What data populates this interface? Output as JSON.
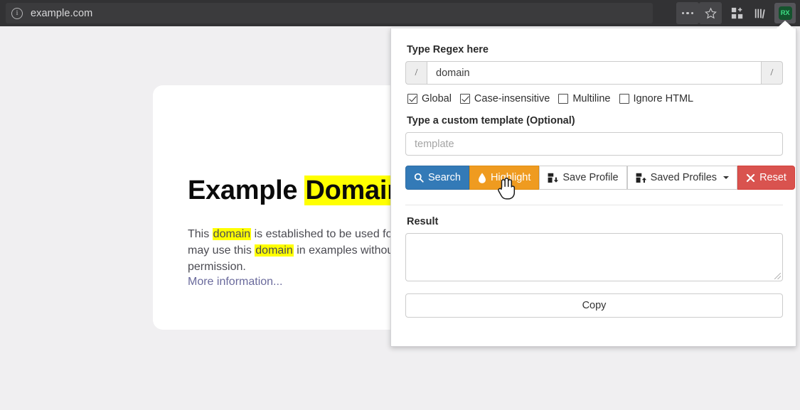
{
  "browser": {
    "url": "example.com",
    "info_icon": "info-icon",
    "actions": [
      {
        "name": "page-actions-ellipsis",
        "icon": "ellipsis-icon"
      },
      {
        "name": "bookmark-star",
        "icon": "star-icon"
      },
      {
        "name": "extensions-add",
        "icon": "extensions-grid-plus-icon"
      },
      {
        "name": "library",
        "icon": "library-bars-icon"
      }
    ],
    "extension_button": {
      "label": "RX",
      "icon": "regex-extension-icon",
      "active": true
    },
    "chrome_bg": "#323234",
    "urlbar_bg": "#3b3b3d"
  },
  "webpage": {
    "heading_pre": "Example ",
    "heading_highlight": "Domain",
    "paragraph_1": "This ",
    "paragraph_hl_1": "domain",
    "paragraph_2": " is established to be used fo",
    "paragraph_3": "may use this ",
    "paragraph_hl_2": "domain",
    "paragraph_4": " in examples withou",
    "paragraph_5": "permission.",
    "link": "More information...",
    "highlight_color": "#ffff00",
    "background": "#f0eff1"
  },
  "popup": {
    "regex_label": "Type Regex here",
    "regex_prefix": "/",
    "regex_suffix": "/",
    "regex_value": "domain",
    "regex_placeholder": "",
    "options": [
      {
        "label": "Global",
        "checked": true
      },
      {
        "label": "Case-insensitive",
        "checked": true
      },
      {
        "label": "Multiline",
        "checked": false
      },
      {
        "label": "Ignore HTML",
        "checked": false
      }
    ],
    "template_label": "Type a custom template (Optional)",
    "template_value": "",
    "template_placeholder": "template",
    "buttons": [
      {
        "label": "Search",
        "icon": "magnifier-icon",
        "color": "#337ab7"
      },
      {
        "label": "Highlight",
        "icon": "droplet-icon",
        "color": "#ef9b20"
      },
      {
        "label": "Save Profile",
        "icon": "save-download-icon",
        "color": "#ffffff"
      },
      {
        "label": "Saved Profiles",
        "icon": "save-upload-icon",
        "color": "#ffffff"
      },
      {
        "label": "Reset",
        "icon": "x-icon",
        "color": "#d9534f"
      }
    ],
    "result_label": "Result",
    "result_value": "",
    "copy_label": "Copy"
  }
}
